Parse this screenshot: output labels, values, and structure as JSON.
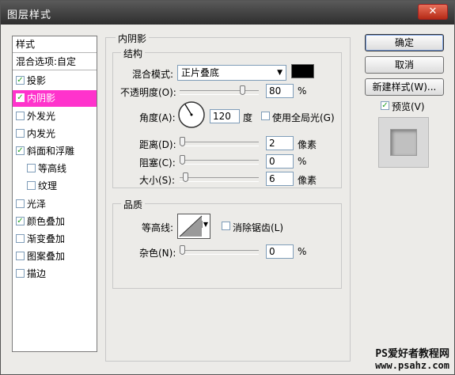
{
  "window": {
    "title": "图层样式",
    "close_symbol": "✕"
  },
  "styles_panel": {
    "header": "样式",
    "blend_options": "混合选项:自定",
    "items": [
      {
        "label": "投影",
        "checked": true
      },
      {
        "label": "内阴影",
        "checked": true,
        "selected": true
      },
      {
        "label": "外发光",
        "checked": false
      },
      {
        "label": "内发光",
        "checked": false
      },
      {
        "label": "斜面和浮雕",
        "checked": true
      },
      {
        "label": "等高线",
        "checked": false
      },
      {
        "label": "纹理",
        "checked": false
      },
      {
        "label": "光泽",
        "checked": false
      },
      {
        "label": "颜色叠加",
        "checked": true
      },
      {
        "label": "渐变叠加",
        "checked": false
      },
      {
        "label": "图案叠加",
        "checked": false
      },
      {
        "label": "描边",
        "checked": false
      }
    ]
  },
  "inner_shadow": {
    "group_title": "内阴影",
    "structure": {
      "title": "结构",
      "blend_mode_label": "混合模式:",
      "blend_mode_value": "正片叠底",
      "shadow_color": "#000000",
      "opacity_label": "不透明度(O):",
      "opacity_value": "80",
      "opacity_unit": "%",
      "angle_label": "角度(A):",
      "angle_value": "120",
      "angle_unit": "度",
      "global_light_label": "使用全局光(G)",
      "global_light_checked": false,
      "distance_label": "距离(D):",
      "distance_value": "2",
      "distance_unit": "像素",
      "choke_label": "阻塞(C):",
      "choke_value": "0",
      "choke_unit": "%",
      "size_label": "大小(S):",
      "size_value": "6",
      "size_unit": "像素"
    },
    "quality": {
      "title": "品质",
      "contour_label": "等高线:",
      "anti_alias_label": "消除锯齿(L)",
      "anti_alias_checked": false,
      "noise_label": "杂色(N):",
      "noise_value": "0",
      "noise_unit": "%"
    }
  },
  "buttons": {
    "ok": "确定",
    "cancel": "取消",
    "new_style": "新建样式(W)...",
    "preview_label": "预览(V)",
    "preview_checked": true
  },
  "watermark": {
    "line1": "PS爱好者教程网",
    "line2": "www.psahz.com"
  },
  "colors": {
    "selected_row": "#ff33cc",
    "dialog_bg": "#ecebe8"
  }
}
